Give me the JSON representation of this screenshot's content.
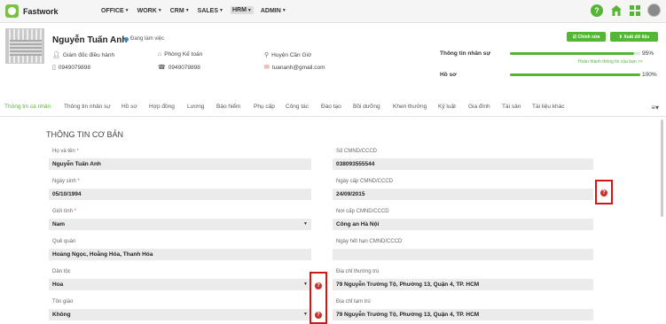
{
  "app": {
    "name": "Fastwork"
  },
  "menu": [
    {
      "label": "OFFICE",
      "active": false
    },
    {
      "label": "WORK",
      "active": false
    },
    {
      "label": "CRM",
      "active": false
    },
    {
      "label": "SALES",
      "active": false
    },
    {
      "label": "HRM",
      "active": true
    },
    {
      "label": "ADMIN",
      "active": false
    }
  ],
  "top_icons": [
    "help-icon",
    "home-icon",
    "apps-grid-icon",
    "user-avatar"
  ],
  "profile": {
    "name": "Nguyễn Tuấn Anh",
    "status": "Đang làm việc",
    "position": "Giám đốc điều hành",
    "department": "Phòng Kế toán",
    "location": "Huyện Cần Giờ",
    "phone1": "0949079898",
    "phone2": "0949079898",
    "email": "tuananh@gmail.com"
  },
  "buttons": {
    "edit": "☑ Chỉnh sửa",
    "export": "⬇ Xuất dữ liệu"
  },
  "stats": {
    "hr_info_label": "Thông tin nhân sự",
    "hr_info_pct": "95%",
    "hr_info_value": 95,
    "hr_hint": "Hoàn thành thông tin của bạn >>",
    "file_label": "Hồ sơ",
    "file_pct": "100%",
    "file_value": 100
  },
  "tabs": [
    "Thông tin cá nhân",
    "Thông tin nhân sự",
    "Hồ sơ",
    "Hợp đồng",
    "Lương",
    "Bảo hiểm",
    "Phụ cấp",
    "Công tác",
    "Đào tạo",
    "Bồi dưỡng",
    "Khen thưởng",
    "Kỷ luật",
    "Gia đình",
    "Tài sản",
    "Tài liệu khác"
  ],
  "section": {
    "title": "THÔNG TIN CƠ BẢN"
  },
  "fields": {
    "fullname": {
      "label": "Họ và tên",
      "required": "*",
      "value": "Nguyễn Tuấn Anh"
    },
    "dob": {
      "label": "Ngày sinh",
      "required": "*",
      "value": "05/10/1994"
    },
    "gender": {
      "label": "Giới tính",
      "required": "*",
      "value": "Nam"
    },
    "hometown": {
      "label": "Quê quán",
      "value": "Hoàng Ngọc, Hoằng Hóa, Thanh Hóa"
    },
    "ethnicity": {
      "label": "Dân tộc",
      "value": "Hoa"
    },
    "religion": {
      "label": "Tôn giáo",
      "value": "Không"
    },
    "id_number": {
      "label": "Số CMND/CCCD",
      "value": "038093555544"
    },
    "id_issue_date": {
      "label": "Ngày cấp CMND/CCCD",
      "value": "24/09/2015"
    },
    "id_issue_place": {
      "label": "Nơi cấp CMND/CCCD",
      "value": "Công an Hà Nội"
    },
    "id_expiry": {
      "label": "Ngày hết hạn CMND/CCCD",
      "value": ""
    },
    "permanent_address": {
      "label": "Địa chỉ thường trú",
      "value": "79 Nguyễn Trường Tộ, Phường 13, Quận 4, TP. HCM"
    },
    "temp_address": {
      "label": "Địa chỉ tạm trú",
      "value": "79 Nguyễn Trường Tộ, Phường 13, Quận 4, TP. HCM"
    }
  },
  "colors": {
    "accent": "#55b535",
    "highlight_box": "#d01818",
    "help_icon": "#c9302c"
  }
}
